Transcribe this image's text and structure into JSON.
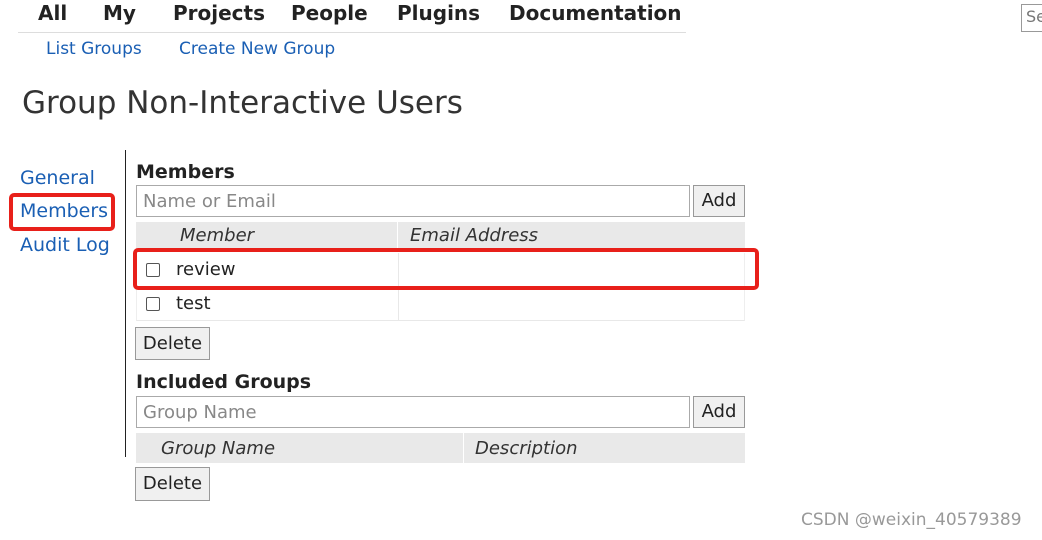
{
  "top_nav": {
    "items": [
      "All",
      "My",
      "Projects",
      "People",
      "Plugins",
      "Documentation"
    ]
  },
  "sub_nav": {
    "list_groups": "List Groups",
    "create_group": "Create New Group"
  },
  "search": {
    "placeholder": "Se"
  },
  "page_title": "Group Non-Interactive Users",
  "side_nav": {
    "general": "General",
    "members": "Members",
    "audit_log": "Audit Log"
  },
  "members": {
    "heading": "Members",
    "input_placeholder": "Name or Email",
    "add_label": "Add",
    "columns": [
      "Member",
      "Email Address"
    ],
    "rows": [
      {
        "member": "review",
        "email": ""
      },
      {
        "member": "test",
        "email": ""
      }
    ],
    "delete_label": "Delete"
  },
  "included_groups": {
    "heading": "Included Groups",
    "input_placeholder": "Group Name",
    "add_label": "Add",
    "columns": [
      "Group Name",
      "Description"
    ],
    "delete_label": "Delete"
  },
  "watermark": "CSDN @weixin_40579389",
  "colors": {
    "link": "#1a5fb4",
    "highlight": "#e8201a",
    "table_header": "#e9e9e9"
  }
}
